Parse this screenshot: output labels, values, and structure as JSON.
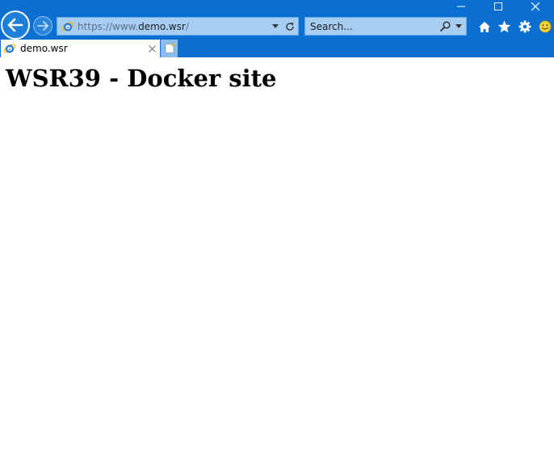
{
  "window": {
    "controls": [
      "minimize",
      "maximize",
      "close"
    ]
  },
  "navigation": {
    "back_icon": "back-arrow-icon",
    "forward_icon": "forward-arrow-icon"
  },
  "address_bar": {
    "url_prefix": "https://www.",
    "url_host": "demo.wsr",
    "url_suffix": "/",
    "site_icon": "ie-logo-icon"
  },
  "search": {
    "placeholder": "Search..."
  },
  "toolbar": {
    "icons": [
      "home-icon",
      "favorites-star-icon",
      "gear-icon",
      "smiley-feedback-icon"
    ]
  },
  "tabs": [
    {
      "label": "demo.wsr",
      "active": true
    }
  ],
  "page": {
    "heading": "WSR39 - Docker site"
  },
  "colors": {
    "chrome": "#0b6fd2",
    "address_bar": "#a8cdf3",
    "tab_active": "#ffffff",
    "new_tab": "#8cbcea"
  }
}
